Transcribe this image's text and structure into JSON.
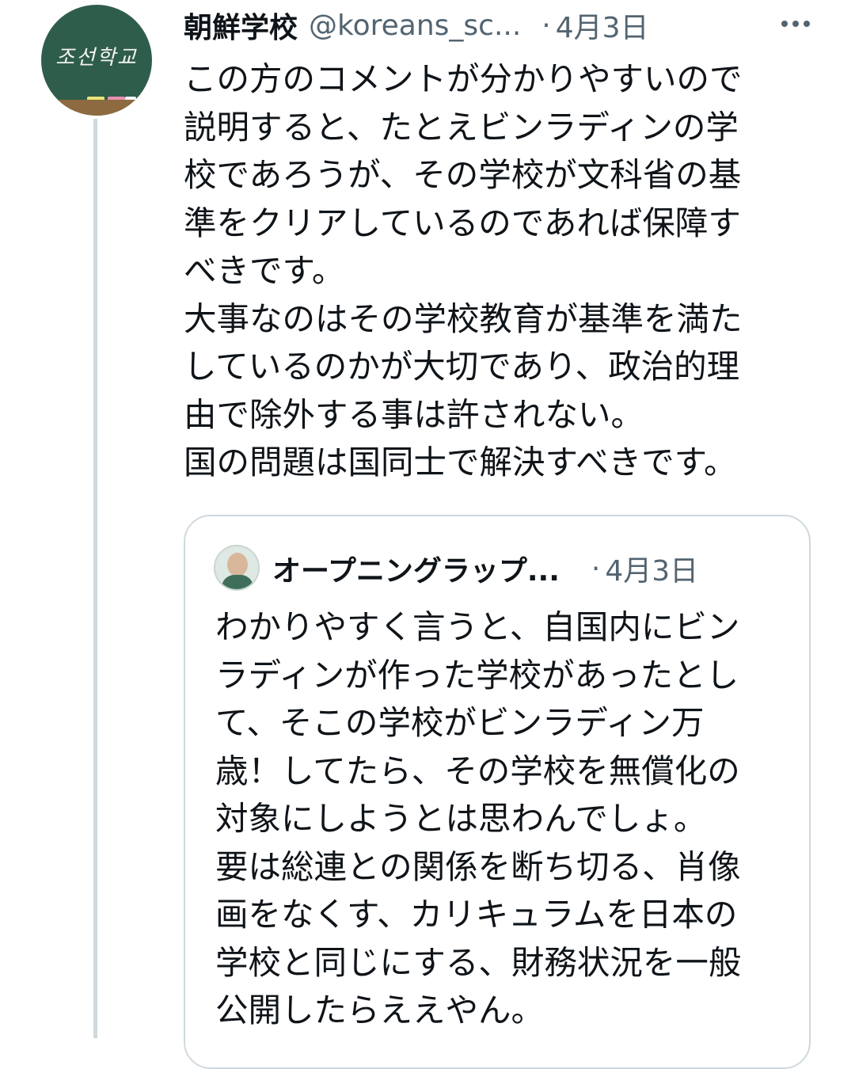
{
  "tweet": {
    "author_name": "朝鮮学校",
    "author_handle": "@koreans_sc...",
    "separator": "·",
    "date": "4月3日",
    "avatar_text": "조선학교",
    "more_icon": "more-horizontal-icon",
    "text": "この方のコメントが分かりやすいので\n説明すると、たとえビンラディンの学\n校であろうが、その学校が文科省の基\n準をクリアしているのであれば保障す\nべきです。\n大事なのはその学校教育が基準を満た\nしているのかが大切であり、政治的理\n由で除外する事は許されない。\n国の問題は国同士で解決すべきです。"
  },
  "quote": {
    "author_name": "オープニングラップ...",
    "separator": "·",
    "date": "4月3日",
    "text": "わかりやすく言うと、自国内にビン\nラディンが作った学校があったとし\nて、そこの学校がビンラディン万\n歳！してたら、その学校を無償化の\n対象にしようとは思わんでしょ。\n要は総連との関係を断ち切る、肖像\n画をなくす、カリキュラムを日本の\n学校と同じにする、財務状況を一般\n公開したらええやん。"
  },
  "colors": {
    "text_primary": "#0f1419",
    "text_secondary": "#536471",
    "border": "#cfd9de",
    "avatar_board": "#2f5d4b"
  }
}
